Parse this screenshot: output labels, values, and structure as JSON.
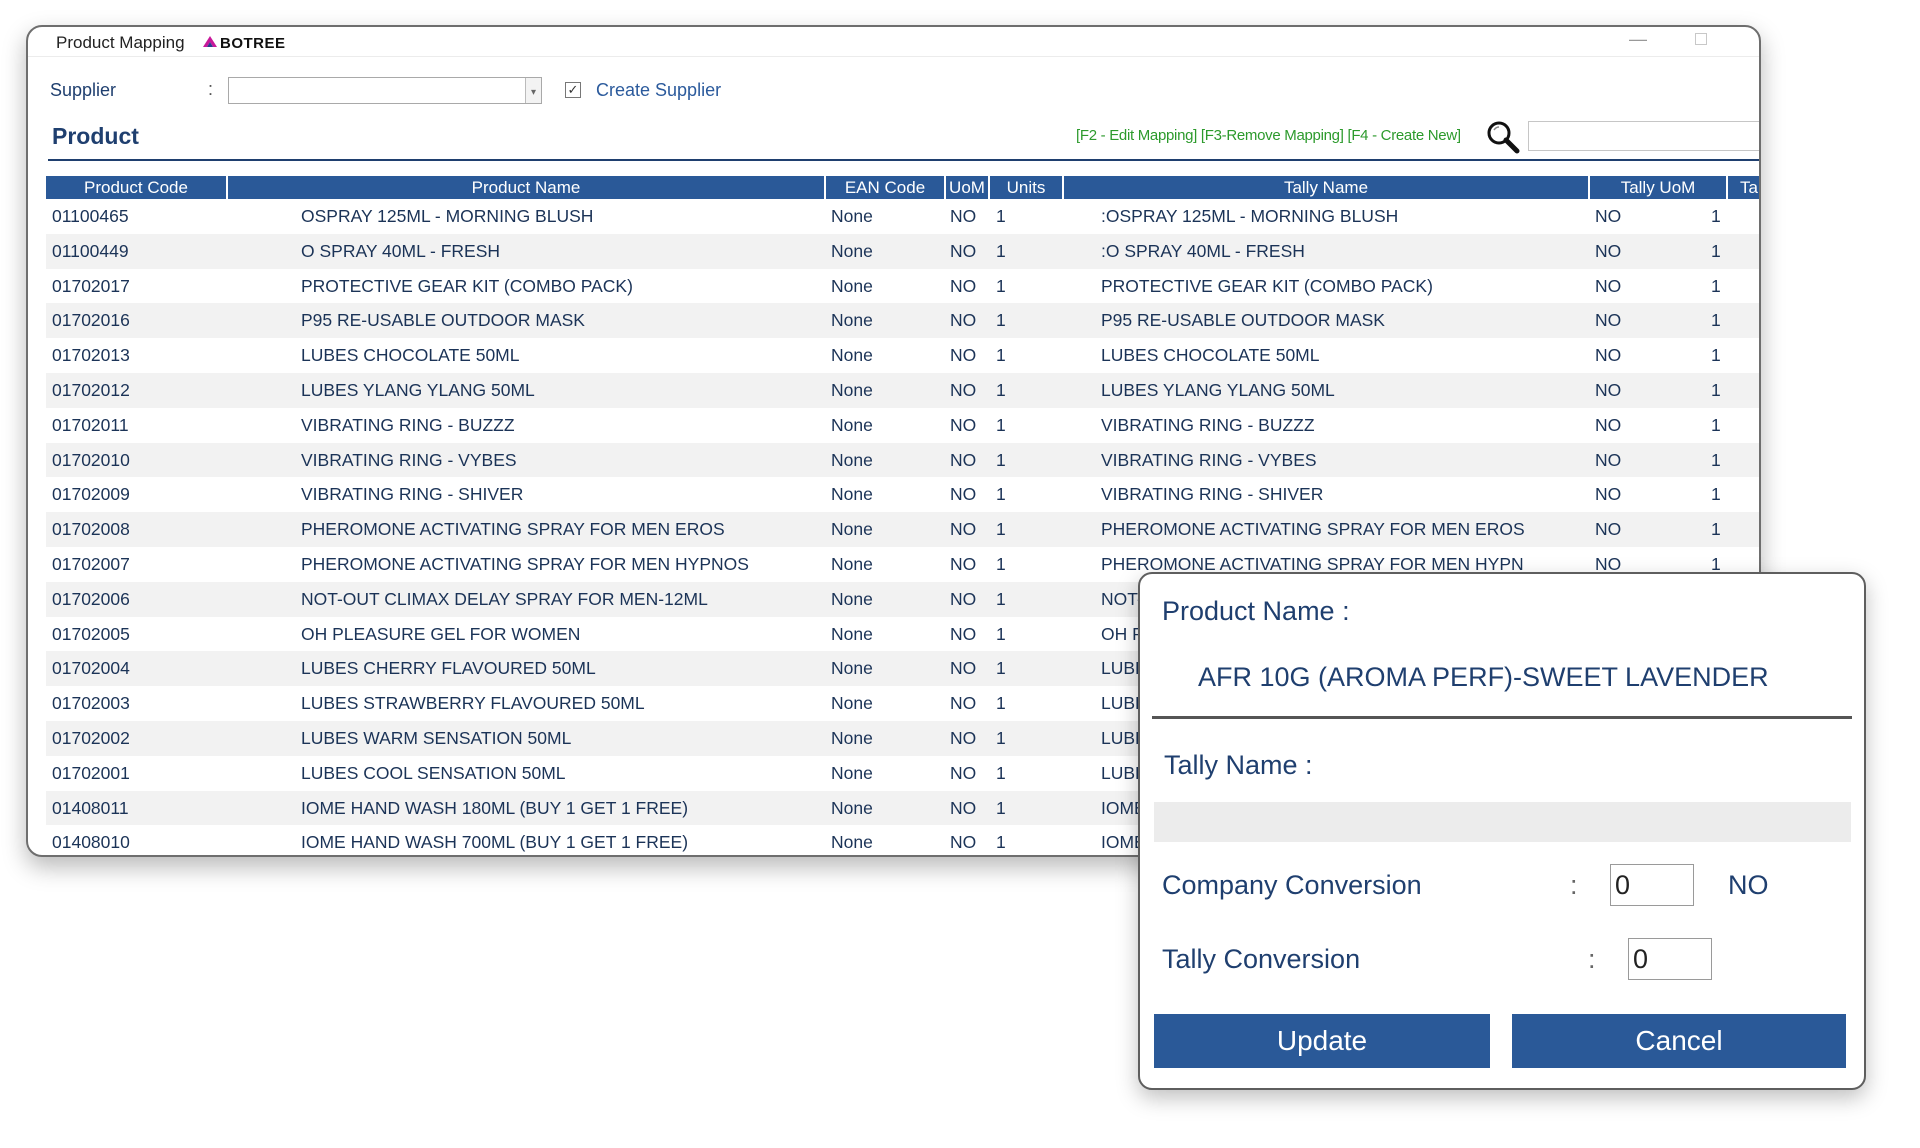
{
  "window": {
    "title": "Product Mapping",
    "logo_text": "BOTREE",
    "minimize_glyph": "—"
  },
  "supplier": {
    "label": "Supplier",
    "colon": ":",
    "value": "",
    "create_supplier_checked": true,
    "create_supplier_label": "Create Supplier"
  },
  "product": {
    "heading": "Product",
    "shortcut_hints": "[F2 - Edit Mapping] [F3-Remove Mapping] [F4 - Create New]",
    "search_value": ""
  },
  "grid": {
    "columns": [
      "Product Code",
      "Product Name",
      "EAN Code",
      "UoM",
      "Units",
      "Tally Name",
      "Tally UoM",
      "Tally"
    ],
    "rows": [
      [
        "01100465",
        "OSPRAY 125ML - MORNING BLUSH",
        "None",
        "NO",
        "1",
        ":OSPRAY 125ML - MORNING BLUSH",
        "NO",
        "1"
      ],
      [
        "01100449",
        "O SPRAY 40ML - FRESH",
        "None",
        "NO",
        "1",
        ":O SPRAY 40ML - FRESH",
        "NO",
        "1"
      ],
      [
        "01702017",
        "PROTECTIVE GEAR KIT (COMBO PACK)",
        "None",
        "NO",
        "1",
        "PROTECTIVE GEAR KIT (COMBO PACK)",
        "NO",
        "1"
      ],
      [
        "01702016",
        "P95 RE-USABLE OUTDOOR MASK",
        "None",
        "NO",
        "1",
        "P95 RE-USABLE OUTDOOR MASK",
        "NO",
        "1"
      ],
      [
        "01702013",
        "LUBES CHOCOLATE 50ML",
        "None",
        "NO",
        "1",
        "LUBES CHOCOLATE 50ML",
        "NO",
        "1"
      ],
      [
        "01702012",
        "LUBES YLANG YLANG 50ML",
        "None",
        "NO",
        "1",
        "LUBES YLANG YLANG 50ML",
        "NO",
        "1"
      ],
      [
        "01702011",
        "VIBRATING RING - BUZZZ",
        "None",
        "NO",
        "1",
        "VIBRATING RING - BUZZZ",
        "NO",
        "1"
      ],
      [
        "01702010",
        "VIBRATING RING - VYBES",
        "None",
        "NO",
        "1",
        "VIBRATING RING - VYBES",
        "NO",
        "1"
      ],
      [
        "01702009",
        "VIBRATING RING - SHIVER",
        "None",
        "NO",
        "1",
        "VIBRATING RING - SHIVER",
        "NO",
        "1"
      ],
      [
        "01702008",
        "PHEROMONE ACTIVATING SPRAY FOR MEN EROS",
        "None",
        "NO",
        "1",
        "PHEROMONE ACTIVATING SPRAY FOR MEN EROS",
        "NO",
        "1"
      ],
      [
        "01702007",
        "PHEROMONE ACTIVATING SPRAY FOR MEN HYPNOS",
        "None",
        "NO",
        "1",
        "PHEROMONE ACTIVATING SPRAY FOR MEN HYPN",
        "NO",
        "1"
      ],
      [
        "01702006",
        "NOT-OUT CLIMAX DELAY SPRAY FOR MEN-12ML",
        "None",
        "NO",
        "1",
        "NOT-",
        "",
        ""
      ],
      [
        "01702005",
        "OH PLEASURE GEL FOR WOMEN",
        "None",
        "NO",
        "1",
        "OH P",
        "",
        ""
      ],
      [
        "01702004",
        "LUBES CHERRY FLAVOURED 50ML",
        "None",
        "NO",
        "1",
        "LUBE",
        "",
        ""
      ],
      [
        "01702003",
        "LUBES STRAWBERRY FLAVOURED 50ML",
        "None",
        "NO",
        "1",
        "LUBE",
        "",
        ""
      ],
      [
        "01702002",
        "LUBES WARM SENSATION 50ML",
        "None",
        "NO",
        "1",
        "LUBE",
        "",
        ""
      ],
      [
        "01702001",
        "LUBES COOL SENSATION 50ML",
        "None",
        "NO",
        "1",
        "LUBE",
        "",
        ""
      ],
      [
        "01408011",
        "IOME HAND WASH 180ML (BUY 1 GET 1 FREE)",
        "None",
        "NO",
        "1",
        "IOME",
        "",
        ""
      ],
      [
        "01408010",
        "IOME HAND WASH 700ML (BUY 1 GET 1 FREE)",
        "None",
        "NO",
        "1",
        "IOME",
        "",
        ""
      ]
    ]
  },
  "dialog": {
    "product_name_label": "Product Name :",
    "product_name_value": "AFR 10G (AROMA PERF)-SWEET LAVENDER",
    "tally_name_label": "Tally Name :",
    "tally_name_value": "",
    "company_conversion_label": "Company Conversion",
    "company_conversion_colon": ":",
    "company_conversion_value": "0",
    "company_conversion_unit": "NO",
    "tally_conversion_label": "Tally Conversion",
    "tally_conversion_colon": ":",
    "tally_conversion_value": "0",
    "update_label": "Update",
    "cancel_label": "Cancel"
  },
  "colors": {
    "header_blue": "#2a5998",
    "text_navy": "#1f3f6f",
    "hint_green": "#2c9a2c"
  }
}
